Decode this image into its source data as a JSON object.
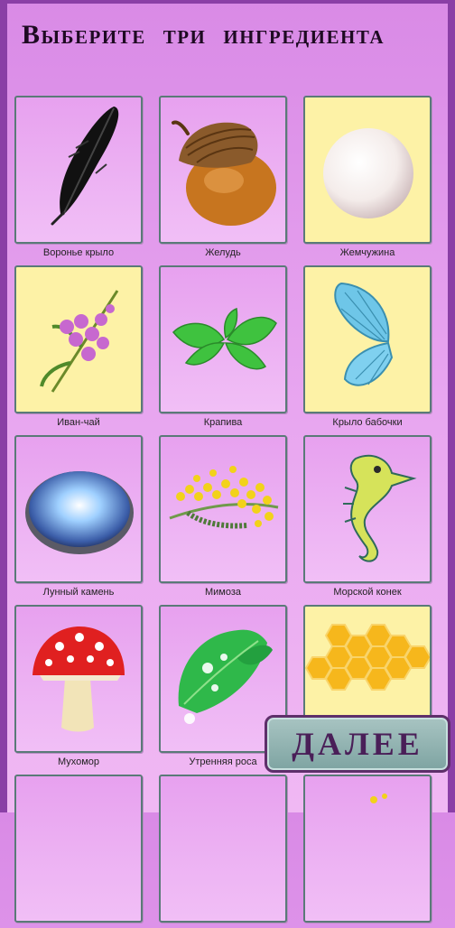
{
  "title": "Выберите три ингредиента",
  "next_button": {
    "label": "ДАЛЕЕ"
  },
  "ingredients": [
    {
      "label": "Воронье крыло",
      "icon": "crow-feather-icon",
      "bg": "pink"
    },
    {
      "label": "Желудь",
      "icon": "acorn-icon",
      "bg": "pink"
    },
    {
      "label": "Жемчужина",
      "icon": "pearl-icon",
      "bg": "yellow"
    },
    {
      "label": "Иван-чай",
      "icon": "fireweed-icon",
      "bg": "yellow"
    },
    {
      "label": "Крапива",
      "icon": "nettle-icon",
      "bg": "pink"
    },
    {
      "label": "Крыло бабочки",
      "icon": "butterfly-wing-icon",
      "bg": "yellow"
    },
    {
      "label": "Лунный камень",
      "icon": "moonstone-icon",
      "bg": "pink"
    },
    {
      "label": "Мимоза",
      "icon": "mimosa-icon",
      "bg": "pink"
    },
    {
      "label": "Морской конек",
      "icon": "seahorse-icon",
      "bg": "pink"
    },
    {
      "label": "Мухомор",
      "icon": "fly-agaric-icon",
      "bg": "pink"
    },
    {
      "label": "Утренняя роса",
      "icon": "morning-dew-icon",
      "bg": "pink"
    },
    {
      "label": "",
      "icon": "honeycomb-icon",
      "bg": "pink"
    },
    {
      "label": "",
      "icon": "blank-icon",
      "bg": "pink"
    },
    {
      "label": "",
      "icon": "blank-icon",
      "bg": "pink"
    },
    {
      "label": "",
      "icon": "sparkle-icon",
      "bg": "pink"
    }
  ]
}
